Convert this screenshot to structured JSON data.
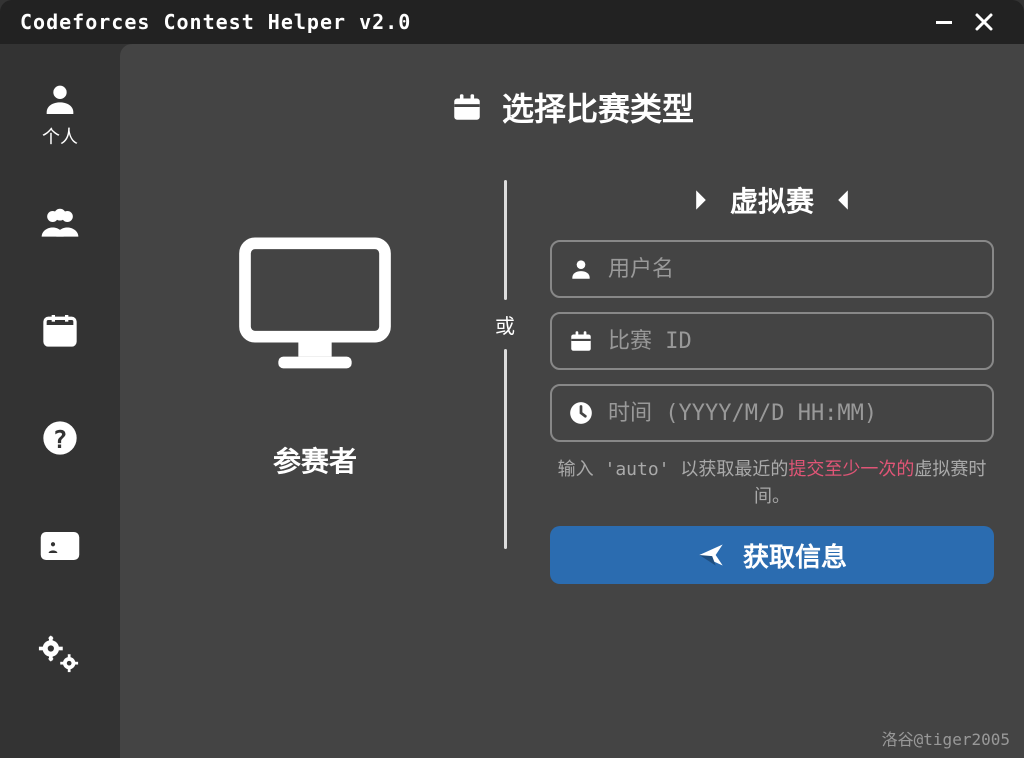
{
  "titlebar": {
    "title": "Codeforces Contest Helper v2.0"
  },
  "sidebar": {
    "items": [
      {
        "label": "个人"
      }
    ]
  },
  "page": {
    "title": "选择比赛类型",
    "or": "或",
    "left_role": "参赛者",
    "virtual_label": "虚拟赛",
    "inputs": {
      "username_placeholder": "用户名",
      "contest_id_placeholder": "比赛 ID",
      "time_placeholder": "时间 (YYYY/M/D HH:MM)"
    },
    "hint_pre": "输入 'auto' 以获取最近的",
    "hint_hot": "提交至少一次的",
    "hint_post": "虚拟赛时间。",
    "fetch_label": "获取信息"
  },
  "watermark": "洛谷@tiger2005"
}
